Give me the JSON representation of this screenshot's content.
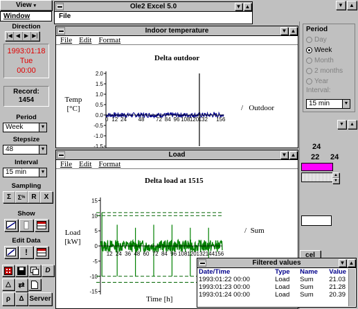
{
  "app_menu": {
    "view": "View",
    "window": "Window"
  },
  "sidebar": {
    "direction_label": "Direction",
    "date": "1993:01:18",
    "weekday": "Tue",
    "time": "00:00",
    "record_label": "Record:",
    "record_value": "1454",
    "period_label": "Period",
    "period_value": "Week",
    "stepsize_label": "Stepsize",
    "stepsize_value": "48",
    "interval_label": "Interval",
    "interval_value": "15 min",
    "sampling_label": "Sampling",
    "show_label": "Show",
    "edit_data_label": "Edit Data",
    "server_label": "Server"
  },
  "ole_window": {
    "title": "Ole2 Excel 5.0",
    "menu_file": "File"
  },
  "indoor_window": {
    "title": "Indoor temperature",
    "menus": [
      "File",
      "Edit",
      "Format"
    ]
  },
  "load_window": {
    "title": "Load",
    "menus": [
      "File",
      "Edit",
      "Format"
    ]
  },
  "period_panel": {
    "label": "Period",
    "options": [
      "Day",
      "Week",
      "Month",
      "2 months",
      "Year"
    ],
    "selected": "Week",
    "interval_label": "Interval:",
    "interval_value": "15 min"
  },
  "bg_panel": {
    "labels": [
      "24",
      "22",
      "24"
    ],
    "highlight_color": "#ff00ff",
    "button_fragment": "cel"
  },
  "filtered_window": {
    "title": "Filtered values",
    "columns": [
      "Date/Time",
      "Type",
      "Name",
      "Value"
    ],
    "rows": [
      [
        "1993:01:22 00:00",
        "Load",
        "Sum",
        "21.03"
      ],
      [
        "1993:01:23 00:00",
        "Load",
        "Sum",
        "21.28"
      ],
      [
        "1993:01:24 00:00",
        "Load",
        "Sum",
        "20.39"
      ]
    ]
  },
  "chart_data": [
    {
      "type": "line",
      "title": "Delta outdoor",
      "ylabel": "Temp\n[°C]",
      "series": [
        {
          "name": "Outdoor",
          "color": "#00008b"
        }
      ],
      "x_ticks": [
        0,
        12,
        24,
        36,
        48,
        60,
        72,
        84,
        96,
        108,
        120,
        132,
        144,
        156
      ],
      "x_tick_labels": [
        "0",
        "12",
        "24",
        "48",
        "72",
        "84",
        "96",
        "108",
        "120",
        "132",
        "156"
      ],
      "y_ticks": [
        2.0,
        1.5,
        1.0,
        0.5,
        0.0,
        -0.5,
        -1.0,
        -1.5
      ],
      "ylim": [
        -1.6,
        2.1
      ],
      "xlim": [
        0,
        160
      ],
      "grid": false,
      "legend": "right",
      "description_values": {
        "baseline": 0.0,
        "noise_amplitude": 0.12,
        "spikes": [
          {
            "x": 127,
            "low": -1.5,
            "high": 2.0
          }
        ]
      }
    },
    {
      "type": "line",
      "title": "Delta load at 1515",
      "ylabel": "Load\n[kW]",
      "xlabel": "Time [h]",
      "series": [
        {
          "name": "Sum",
          "color": "#008000"
        }
      ],
      "x_tick_labels": [
        "12",
        "24",
        "36",
        "48",
        "60",
        "72",
        "84",
        "96",
        "108",
        "120",
        "132",
        "144",
        "156"
      ],
      "x_ticks": [
        12,
        24,
        36,
        48,
        60,
        72,
        84,
        96,
        108,
        120,
        132,
        144,
        156
      ],
      "y_ticks": [
        15,
        10,
        5,
        0,
        -5,
        -10,
        -15
      ],
      "ylim": [
        -16,
        16
      ],
      "xlim": [
        0,
        160
      ],
      "reference_lines": [
        10,
        11,
        -10,
        -12
      ],
      "grid": false,
      "legend": "right",
      "description_values": {
        "baseline": 0.0,
        "noise_amplitude": 2.0,
        "spikes": [
          {
            "x": 2,
            "low": -10,
            "high": 11
          },
          {
            "x": 22,
            "low": -10,
            "high": 7
          },
          {
            "x": 46,
            "low": -10,
            "high": 6
          },
          {
            "x": 70,
            "low": -10,
            "high": 7
          },
          {
            "x": 94,
            "low": -10,
            "high": 7
          },
          {
            "x": 118,
            "low": -10,
            "high": 6
          },
          {
            "x": 142,
            "low": -10,
            "high": 6
          }
        ]
      }
    }
  ]
}
